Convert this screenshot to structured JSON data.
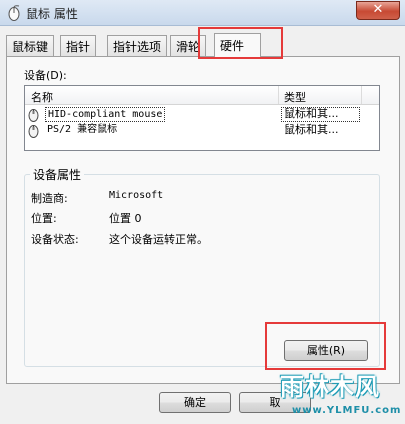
{
  "window": {
    "title": "鼠标 属性",
    "close_glyph": "✕"
  },
  "tabs": [
    {
      "label": "鼠标键",
      "active": false
    },
    {
      "label": "指针",
      "active": false
    },
    {
      "label": "指针选项",
      "active": false
    },
    {
      "label": "滑轮",
      "active": false
    },
    {
      "label": "硬件",
      "active": true
    }
  ],
  "devices": {
    "label": "设备(D):",
    "columns": [
      "名称",
      "类型"
    ],
    "rows": [
      {
        "name": "HID-compliant mouse",
        "type": "鼠标和其...",
        "selected": true,
        "icon": "mouse-icon"
      },
      {
        "name": "PS/2 兼容鼠标",
        "type": "鼠标和其...",
        "selected": false,
        "icon": "mouse-icon"
      }
    ]
  },
  "device_properties": {
    "title": "设备属性",
    "fields": [
      {
        "label": "制造商:",
        "value": "Microsoft"
      },
      {
        "label": "位置:",
        "value": "位置 0"
      },
      {
        "label": "设备状态:",
        "value": "这个设备运转正常。"
      }
    ],
    "properties_button": "属性(R)"
  },
  "footer": {
    "ok_button": "确定",
    "cancel_button": "取"
  },
  "watermark": {
    "text": "雨林木风",
    "url": "www.YLMFU.com"
  },
  "colors": {
    "highlight": "#e53a3a",
    "accent": "#1c9bb5"
  }
}
